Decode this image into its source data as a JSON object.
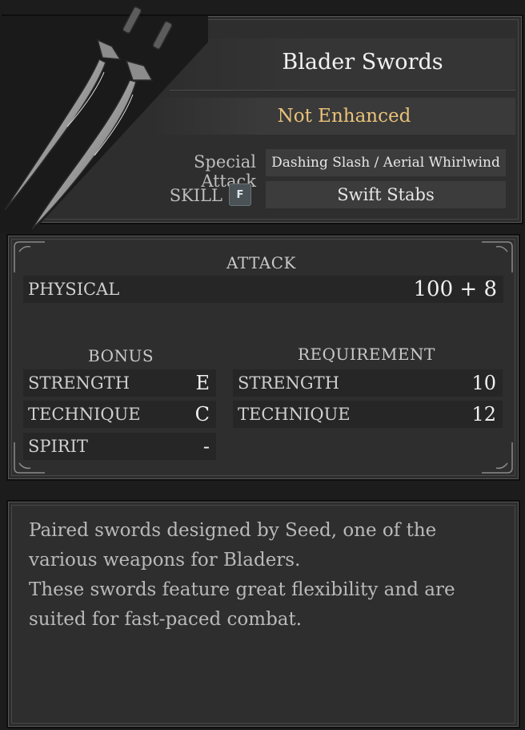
{
  "weapon": {
    "name": "Blader Swords",
    "enhancement": "Not Enhanced",
    "special_attack_label": "Special Attack",
    "special_attack_value": "Dashing Slash / Aerial Whirlwind",
    "skill_label": "SKILL",
    "skill_key": "F",
    "skill_value": "Swift Stabs"
  },
  "attack": {
    "title": "ATTACK",
    "physical_label": "PHYSICAL",
    "physical_value": "100 + 8"
  },
  "bonus": {
    "title": "BONUS",
    "rows": [
      {
        "label": "STRENGTH",
        "value": "E"
      },
      {
        "label": "TECHNIQUE",
        "value": "C"
      },
      {
        "label": "SPIRIT",
        "value": "-"
      }
    ]
  },
  "requirement": {
    "title": "REQUIREMENT",
    "rows": [
      {
        "label": "STRENGTH",
        "value": "10"
      },
      {
        "label": "TECHNIQUE",
        "value": "12"
      }
    ]
  },
  "description": {
    "line1": "Paired swords designed by Seed, one of the",
    "line2": "various weapons for Bladers.",
    "line3": "These swords feature great flexibility and are",
    "line4": "suited for fast-paced combat."
  },
  "colors": {
    "enhancement_text": "#e9c27a",
    "panel_bg": "#2e2e2e",
    "key_badge": "#4a5256"
  },
  "icons": [
    "blader-swords-icon",
    "f-key-icon"
  ]
}
